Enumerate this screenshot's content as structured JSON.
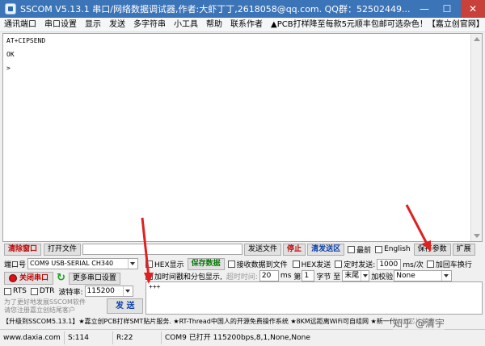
{
  "window": {
    "title": "SSCOM V5.13.1 串口/网络数据调试器,作者:大虾丁丁,2618058@qq.com. QQ群：52502449...",
    "minimize": "—",
    "maximize": "☐",
    "close": "✕"
  },
  "menu": [
    "通讯端口",
    "串口设置",
    "显示",
    "发送",
    "多字符串",
    "小工具",
    "帮助",
    "联系作者",
    "▲PCB打样降至每款5元顺丰包邮可选杂色！【嘉立创官网】"
  ],
  "receive": {
    "lines": [
      "AT+CIPSEND",
      "",
      "OK",
      ">"
    ]
  },
  "toolbar1": {
    "clear_window": "清除窗口",
    "open_file": "打开文件",
    "send_file": "发送文件",
    "stop": "停止",
    "clear_send": "清发送区",
    "latest": "最前",
    "english": "English",
    "save_params": "保存参数",
    "expand": "扩展"
  },
  "port": {
    "label": "端口号",
    "value": "COM9 USB-SERIAL CH340",
    "close_port": "关闭串口",
    "more_settings": "更多串口设置",
    "rts": "RTS",
    "dtr": "DTR",
    "baud_label": "波特率:",
    "baud_value": "115200",
    "note1": "为了更好地发展SSCOM软件",
    "note2": "请您注册嘉立创结尾客户",
    "send": "发 送"
  },
  "options": {
    "hex_display": "HEX显示",
    "save_data": "保存数据",
    "receive_to_file": "接收数据到文件",
    "hex_send": "HEX发送",
    "timed_send": "定时发送:",
    "interval_value": "1000",
    "interval_unit": "ms/次",
    "add_crlf": "加回车换行",
    "timestamp": "加时间戳和分包显示,",
    "timeout_label": "超时时间:",
    "timeout_value": "20",
    "timeout_unit": "ms",
    "byte_label": "第",
    "byte_value": "1",
    "byte_unit": "字节 至",
    "end_value": "末尾",
    "checksum_label": "加校验",
    "checksum_value": "None"
  },
  "send_text": "+++",
  "adbar": "【升级到SSCOM5.13.1】★嘉立创PCB打样SMT贴片服务. ★RT-Thread中国人的开源免费操作系统 ★8KM远距离WiFi可自组网 ★新一代WiFi芯片兼容",
  "watermark": "知乎 @清宇",
  "status": {
    "website": "www.daxia.com",
    "sent": "S:114",
    "received": "R:22",
    "port_state": "COM9 已打开  115200bps,8,1,None,None"
  },
  "colors": {
    "titlebar": "#3c74b8",
    "annotation_arrow": "#e02020",
    "save_data_green": "#0a7a0a",
    "clear_red": "#c00000"
  }
}
